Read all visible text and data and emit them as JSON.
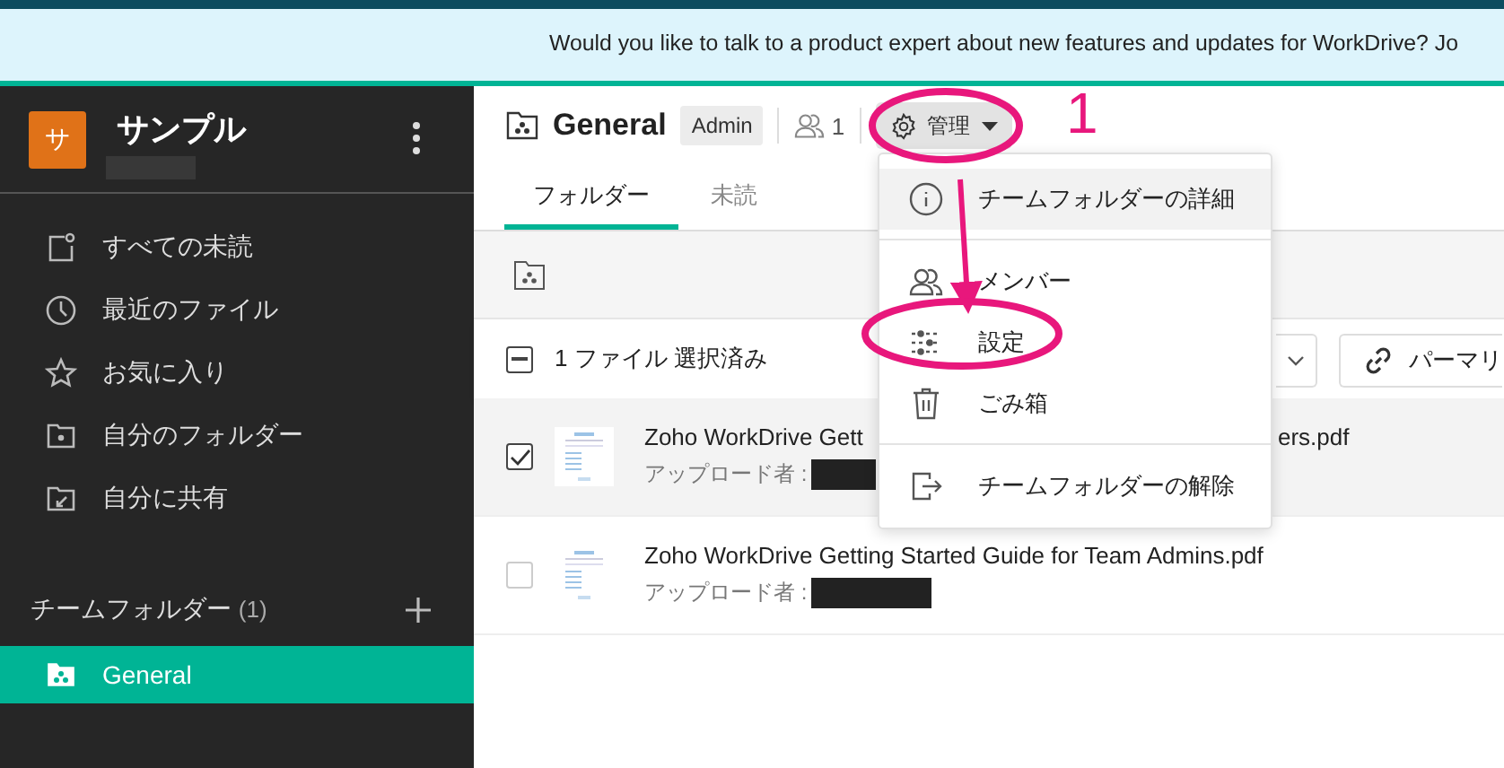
{
  "banner": {
    "text": "Would you like to talk to a product expert about new features and updates for WorkDrive? Jo"
  },
  "sidebar": {
    "workspace": {
      "avatar": "サ",
      "name": "サンプル"
    },
    "items": [
      {
        "label": "すべての未読",
        "selected": false
      },
      {
        "label": "最近のファイル",
        "selected": false
      },
      {
        "label": "お気に入り",
        "selected": false
      },
      {
        "label": "自分のフォルダー",
        "selected": false
      },
      {
        "label": "自分に共有",
        "selected": false
      }
    ],
    "team_folders": {
      "label": "チームフォルダー",
      "count": "(1)",
      "items": [
        {
          "label": "General",
          "selected": true
        }
      ]
    }
  },
  "header": {
    "title": "General",
    "role": "Admin",
    "members": "1",
    "manage_button": "管理"
  },
  "tabs": [
    {
      "label": "フォルダー",
      "selected": true
    },
    {
      "label": "未読",
      "selected": false
    }
  ],
  "selection": {
    "text": "1 ファイル 選択済み",
    "indeterminate": true,
    "permalink_button": "パーマリ"
  },
  "files": [
    {
      "name": "Zoho WorkDrive Gett",
      "name_tail": "ers.pdf",
      "uploader_label": "アップロード者 :",
      "checked": true
    },
    {
      "name": "Zoho WorkDrive Getting Started Guide for Team Admins.pdf",
      "uploader_label": "アップロード者 :",
      "checked": false
    }
  ],
  "menu": {
    "groups": [
      [
        {
          "label": "チームフォルダーの詳細",
          "highlighted": true
        }
      ],
      [
        {
          "label": "メンバー",
          "highlighted": false
        },
        {
          "label": "設定",
          "highlighted": false
        },
        {
          "label": "ごみ箱",
          "highlighted": false
        }
      ],
      [
        {
          "label": "チームフォルダーの解除",
          "highlighted": false
        }
      ]
    ]
  },
  "annotation": {
    "step_number": "1"
  }
}
